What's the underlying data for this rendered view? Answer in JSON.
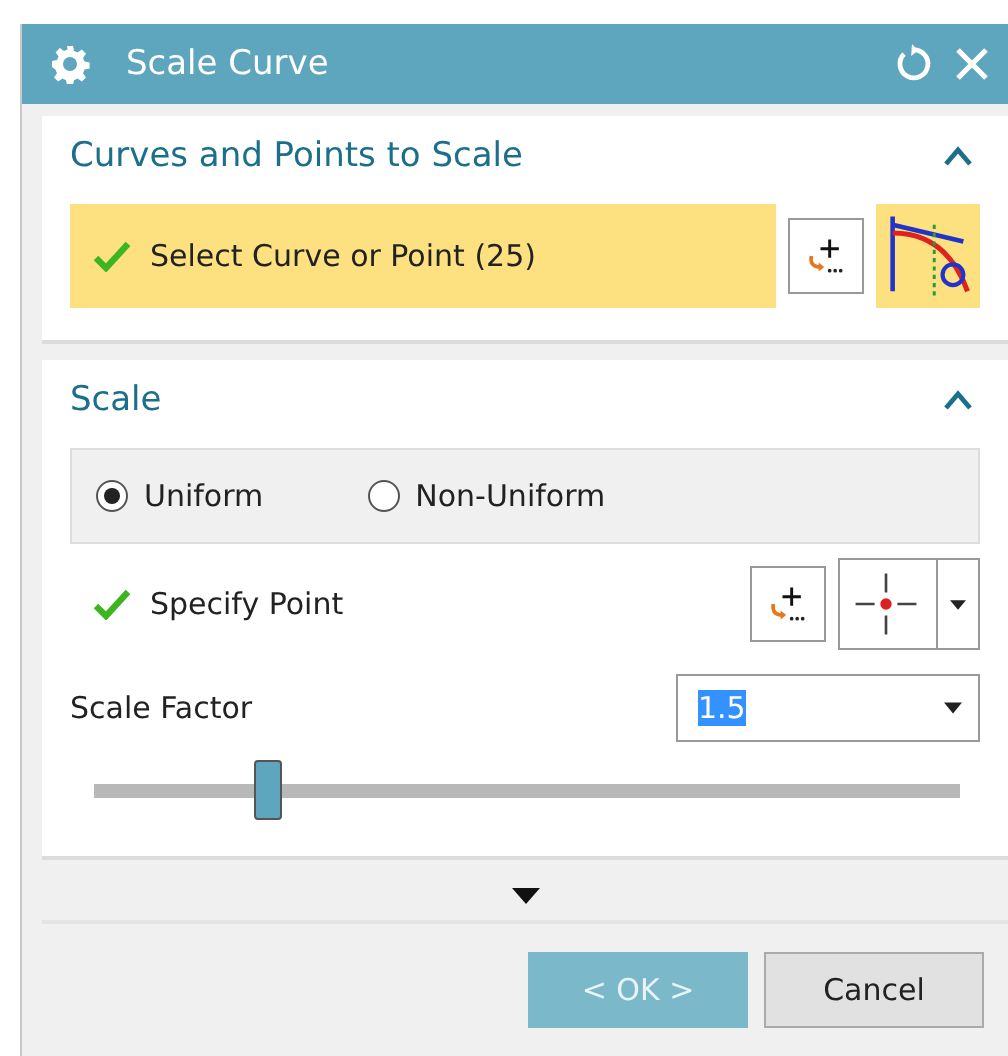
{
  "window": {
    "title": "Scale Curve"
  },
  "sections": [
    {
      "title": "Curves and Points to Scale",
      "expanded": true,
      "rows": [
        {
          "kind": "selection",
          "label": "Select Curve or Point (25)",
          "done": true,
          "highlighted": true
        }
      ]
    },
    {
      "title": "Scale",
      "expanded": true,
      "rows": [
        {
          "kind": "radio",
          "options": [
            {
              "label": "Uniform",
              "selected": true
            },
            {
              "label": "Non-Uniform",
              "selected": false
            }
          ]
        },
        {
          "kind": "point",
          "label": "Specify Point",
          "done": true,
          "highlighted": false
        },
        {
          "kind": "dropdown",
          "label": "Scale Factor",
          "value": "1.5",
          "value_selected": true
        },
        {
          "kind": "slider",
          "level": 0.2
        }
      ]
    }
  ],
  "buttons": [
    {
      "label": "< OK >",
      "kind": "primary"
    },
    {
      "label": "Cancel",
      "kind": "normal"
    }
  ]
}
